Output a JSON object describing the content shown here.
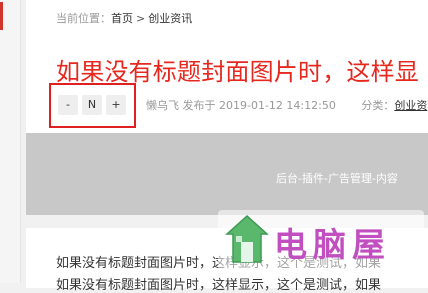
{
  "breadcrumb": {
    "prefix": "当前位置：",
    "home": "首页",
    "separator": ">",
    "category": "创业资讯"
  },
  "article": {
    "title": "如果没有标题封面图片时，这样显",
    "font_controls": {
      "decrease": "-",
      "normal": "N",
      "increase": "+"
    },
    "meta": {
      "author": "懒乌飞",
      "published": "发布于 2019-01-12 14:12:50",
      "category_label": "分类：",
      "category": "创业资"
    },
    "banner_text": "后台-插件-广告管理-内容",
    "body_line1": "如果没有标题封面图片时，这样显示，这个是测试，如果",
    "body_line2": "如果没有标题封面图片时，这样显示，这个是测试，如果"
  },
  "watermark": {
    "text": "电脑屋",
    "icon": "house-icon"
  },
  "colors": {
    "title": "#e6281f",
    "highlight": "#e02020",
    "watermark": "#c24fc0"
  }
}
